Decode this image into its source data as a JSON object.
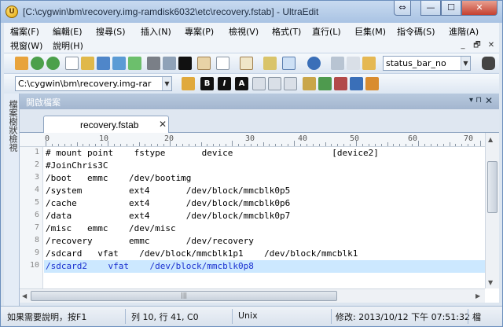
{
  "window": {
    "title": "[C:\\cygwin\\bm\\recovery.img-ramdisk6032\\etc\\recovery.fstab] - UltraEdit",
    "app_icon_letter": "U"
  },
  "caption_buttons": {
    "restore_size": "⇔",
    "minimize": "—",
    "maximize": "☐",
    "close": "✕"
  },
  "menu": {
    "row1": [
      "檔案(F)",
      "編輯(E)",
      "搜尋(S)",
      "插入(N)",
      "專案(P)",
      "檢視(V)",
      "格式(T)",
      "直行(L)",
      "巨集(M)",
      "指令碼(S)",
      "進階(A)"
    ],
    "row2": [
      "視窗(W)",
      "說明(H)"
    ],
    "mdi_buttons": [
      "_",
      "🗗",
      "✕"
    ]
  },
  "toolbar1": {
    "function_combo": "status_bar_no",
    "binoculars_icon": "binoculars-icon"
  },
  "toolbar2": {
    "path_combo": "C:\\cygwin\\bm\\recovery.img-rar",
    "bold_label": "B",
    "italic_label": "I",
    "text_label": "A"
  },
  "side_panel": {
    "label": "檔案樹狀檢視"
  },
  "open_files_panel": {
    "title": "開啟檔案",
    "pin": "▾ ⊓",
    "close": "✕"
  },
  "document_tab": {
    "label": "recovery.fstab",
    "close": "✕"
  },
  "ruler": {
    "labels": [
      "0",
      "10",
      "20",
      "30",
      "40",
      "50",
      "60",
      "70"
    ]
  },
  "editor": {
    "lines": [
      {
        "num": "1",
        "text": "# mount point    fstype       device                   [device2]"
      },
      {
        "num": "2",
        "text": "#JoinChris3C"
      },
      {
        "num": "3",
        "text": "/boot   emmc    /dev/bootimg"
      },
      {
        "num": "4",
        "text": "/system         ext4       /dev/block/mmcblk0p5"
      },
      {
        "num": "5",
        "text": "/cache          ext4       /dev/block/mmcblk0p6"
      },
      {
        "num": "6",
        "text": "/data           ext4       /dev/block/mmcblk0p7"
      },
      {
        "num": "7",
        "text": "/misc   emmc    /dev/misc"
      },
      {
        "num": "8",
        "text": "/recovery       emmc       /dev/recovery"
      },
      {
        "num": "9",
        "text": "/sdcard   vfat    /dev/block/mmcblk1p1    /dev/block/mmcblk1"
      },
      {
        "num": "10",
        "text": "/sdcard2    vfat    /dev/block/mmcblk0p8",
        "current": true
      }
    ]
  },
  "status_bar": {
    "help": "如果需要說明，按F1",
    "position": "列 10, 行 41, C0",
    "line_ending": "Unix",
    "modified": "修改: 2013/10/12 下午 07:51:32",
    "file_size": "檔"
  },
  "colors": {
    "current_line_bg": "#cce8ff",
    "current_line_text": "#1a30d0",
    "panel_header": "#a3b6cf"
  }
}
